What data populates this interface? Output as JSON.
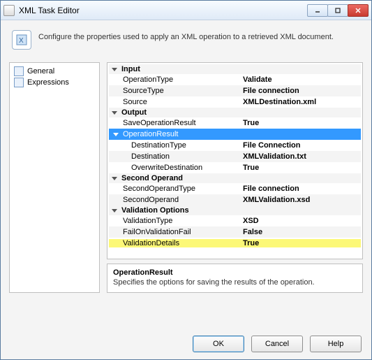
{
  "window": {
    "title": "XML Task Editor"
  },
  "description": "Configure the properties used to apply an XML operation to a retrieved XML document.",
  "nav": {
    "items": [
      {
        "label": "General"
      },
      {
        "label": "Expressions"
      }
    ]
  },
  "grid": {
    "cat_input": "Input",
    "op_type_l": "OperationType",
    "op_type_v": "Validate",
    "src_type_l": "SourceType",
    "src_type_v": "File connection",
    "src_l": "Source",
    "src_v": "XMLDestination.xml",
    "cat_output": "Output",
    "save_l": "SaveOperationResult",
    "save_v": "True",
    "opres_l": "OperationResult",
    "opres_v": "",
    "dest_type_l": "DestinationType",
    "dest_type_v": "File Connection",
    "dest_l": "Destination",
    "dest_v": "XMLValidation.txt",
    "over_l": "OverwriteDestination",
    "over_v": "True",
    "cat_second": "Second Operand",
    "so_type_l": "SecondOperandType",
    "so_type_v": "File connection",
    "so_l": "SecondOperand",
    "so_v": "XMLValidation.xsd",
    "cat_valid": "Validation Options",
    "vt_l": "ValidationType",
    "vt_v": "XSD",
    "fail_l": "FailOnValidationFail",
    "fail_v": "False",
    "vd_l": "ValidationDetails",
    "vd_v": "True"
  },
  "help": {
    "title": "OperationResult",
    "text": "Specifies the options for saving the results of the operation."
  },
  "buttons": {
    "ok": "OK",
    "cancel": "Cancel",
    "help": "Help"
  }
}
